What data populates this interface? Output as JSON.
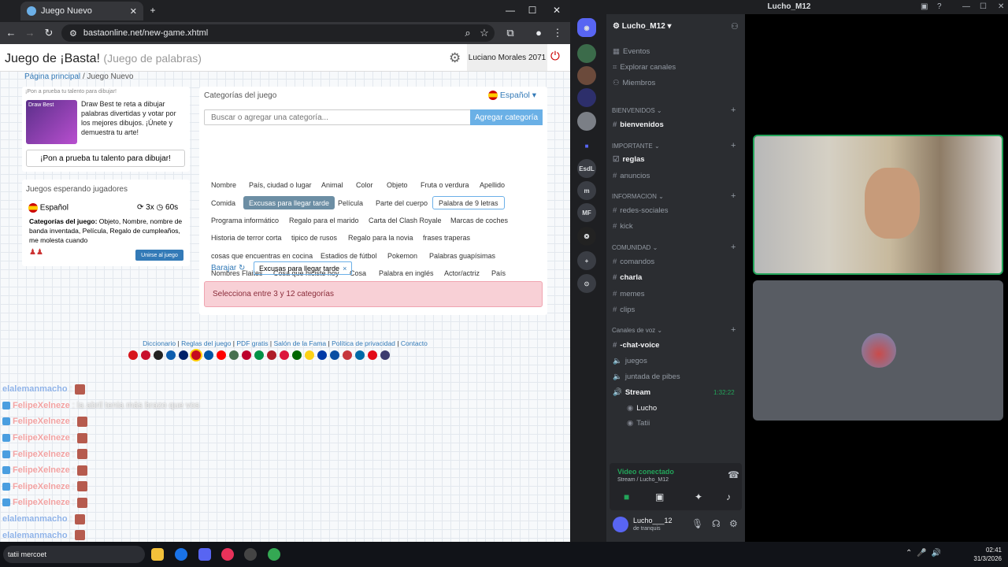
{
  "browser": {
    "tab_title": "Juego Nuevo",
    "url": "bastaonline.net/new-game.xhtml",
    "new_tab": "+",
    "minimize": "—",
    "maximize": "☐",
    "close": "✕"
  },
  "site": {
    "title": "Juego de ¡Basta!",
    "subtitle": "(Juego de palabras)",
    "user": "Luciano Morales 2071",
    "breadcrumb": {
      "home": "Página principal",
      "sep": "/",
      "current": "Juego Nuevo"
    },
    "promo": {
      "small": "¡Pon a prueba tu talento para dibujar!",
      "thumb": "Draw Best",
      "desc": "Draw Best te reta a dibujar palabras divertidas y votar por los mejores dibujos. ¡Únete y demuestra tu arte!",
      "button": "¡Pon a prueba tu talento para dibujar!"
    },
    "waiting": {
      "heading": "Juegos esperando jugadores",
      "lang": "Español",
      "players": "3x",
      "time": "60s",
      "cats_label": "Categorías del juego:",
      "cats": " Objeto, Nombre, nombre de banda inventada, Película, Regalo de cumpleaños, me molesta cuando",
      "join": "Unirse al juego"
    },
    "cats": {
      "heading": "Categorías del juego",
      "lang": "Español",
      "placeholder": "Buscar o agregar una categoría...",
      "add": "Agregar categoría",
      "rows": [
        [
          "Nombre",
          "País, ciudad o lugar",
          "Animal",
          "Color",
          "Objeto",
          "Fruta o verdura",
          "Apellido"
        ],
        [
          "Comida",
          "Excusas para llegar tarde",
          "Película",
          "Parte del cuerpo",
          "Palabra de 9 letras"
        ],
        [
          "Programa informático",
          "Regalo para el marido",
          "Carta del Clash Royale",
          "Marcas de coches"
        ],
        [
          "Historia de terror corta",
          "tipico de rusos",
          "Regalo para la novia",
          "frases traperas"
        ],
        [
          "cosas que encuentras en cocina",
          "Estadios de fútbol",
          "Pokemon",
          "Palabras guapísimas"
        ],
        [
          "Nombres Flaites",
          "Cosa que hiciste hoy",
          "Cosa",
          "Palabra en inglés",
          "Actor/actriz",
          "País"
        ]
      ],
      "barajar": "Barajar ↻",
      "chosen": "Excusas para llegar tarde",
      "alert": "Selecciona entre 3 y 12 categorías"
    },
    "footer": {
      "l1": "Diccionario",
      "l2": "Reglas del juego",
      "l3": "PDF gratis",
      "l4": "Salón de la Fama",
      "l5": "Política de privacidad",
      "l6": "Contacto",
      "sep": "|"
    }
  },
  "chat": [
    {
      "name": "elalemanmacho",
      "text": "",
      "emote": true
    },
    {
      "name": "FelipeXelneze",
      "text": "la abril tenia más brazo que vos",
      "emote": false
    },
    {
      "name": "FelipeXelneze",
      "text": "",
      "emote": true
    },
    {
      "name": "FelipeXelneze",
      "text": "",
      "emote": true
    },
    {
      "name": "FelipeXelneze",
      "text": "",
      "emote": true
    },
    {
      "name": "FelipeXelneze",
      "text": "",
      "emote": true
    },
    {
      "name": "FelipeXelneze",
      "text": "",
      "emote": true
    },
    {
      "name": "FelipeXelneze",
      "text": "",
      "emote": true
    },
    {
      "name": "elalemanmacho",
      "text": "",
      "emote": true
    },
    {
      "name": "elalemanmacho",
      "text": "",
      "emote": true
    }
  ],
  "discord": {
    "window_title": "Lucho_M12",
    "server": "Lucho_M12",
    "servers": [
      "",
      "",
      "",
      "",
      "",
      "EsdL",
      "m",
      "MF"
    ],
    "top": [
      "Eventos",
      "Explorar canales",
      "Miembros"
    ],
    "cat1": "BIENVENIDOS",
    "ch_bienvenidos": "bienvenidos",
    "cat2": "IMPORTANTE",
    "ch_reglas": "reglas",
    "ch_anuncios": "anuncios",
    "cat3": "INFORMACION",
    "ch_redes": "redes-sociales",
    "ch_kick": "kick",
    "cat4": "COMUNIDAD",
    "ch_comandos": "comandos",
    "ch_charla": "charla",
    "ch_memes": "memes",
    "ch_clips": "clips",
    "cat5": "Canales de voz",
    "v1": "-chat-voice",
    "v2": "juegos",
    "v3": "juntada de pibes",
    "v4": "Stream",
    "v4_time": "1:32:22",
    "m1": "Lucho",
    "m2": "Tatii",
    "voice_status": "Video conectado",
    "voice_sub": "Stream / Lucho_M12",
    "user": "Lucho___12",
    "user_status": "de tranquis"
  },
  "taskbar": {
    "search": "tatii mercoet",
    "time": "02:41",
    "date": "31/3/2026"
  },
  "colors": {
    "accent": "#337ab7",
    "discord_green": "#23a55a",
    "alert_bg": "#f8d0d6",
    "chip_selected": "#6c8ea4"
  }
}
